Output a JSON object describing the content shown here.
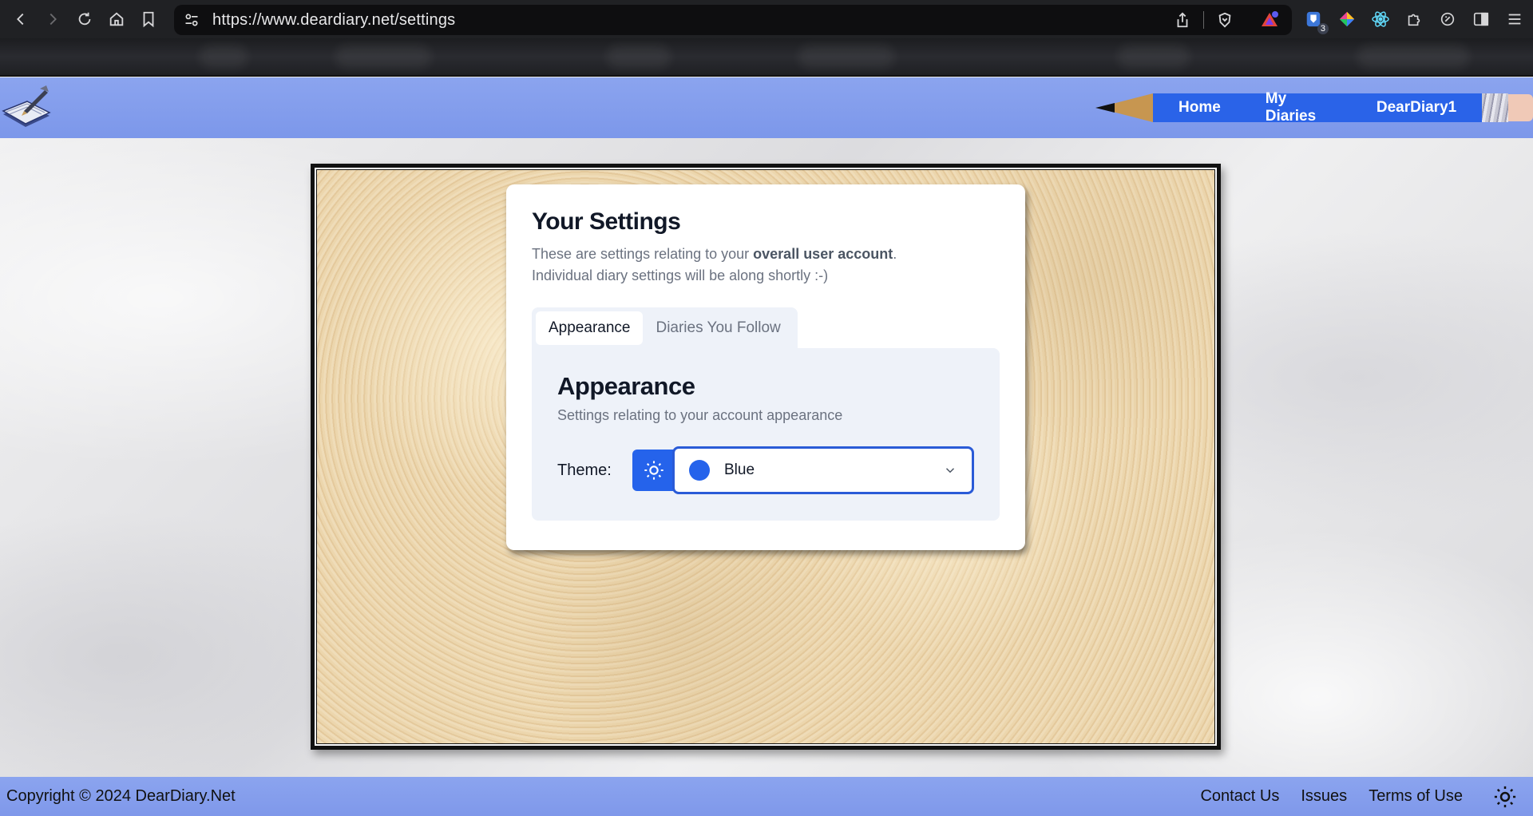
{
  "browser": {
    "url": "https://www.deardiary.net/settings",
    "extension_badge": "3"
  },
  "header": {
    "nav": [
      {
        "label": "Home"
      },
      {
        "label": "My Diaries"
      },
      {
        "label": "DearDiary1"
      }
    ]
  },
  "settings": {
    "title": "Your Settings",
    "desc_prefix": "These are settings relating to your ",
    "desc_bold": "overall user account",
    "desc_suffix": ".",
    "desc_line2": "Individual diary settings will be along shortly :-)",
    "tabs": [
      {
        "label": "Appearance",
        "active": true
      },
      {
        "label": "Diaries You Follow",
        "active": false
      }
    ],
    "panel": {
      "title": "Appearance",
      "description": "Settings relating to your account appearance",
      "theme_label": "Theme:",
      "theme_value": "Blue",
      "theme_color": "#2563eb"
    }
  },
  "footer": {
    "copyright": "Copyright © 2024 DearDiary.Net",
    "links": [
      {
        "label": "Contact Us"
      },
      {
        "label": "Issues"
      },
      {
        "label": "Terms of Use"
      }
    ]
  },
  "colors": {
    "header_bg": "#8ba4ef",
    "nav_blue": "#2a63e8",
    "accent": "#2563eb"
  }
}
